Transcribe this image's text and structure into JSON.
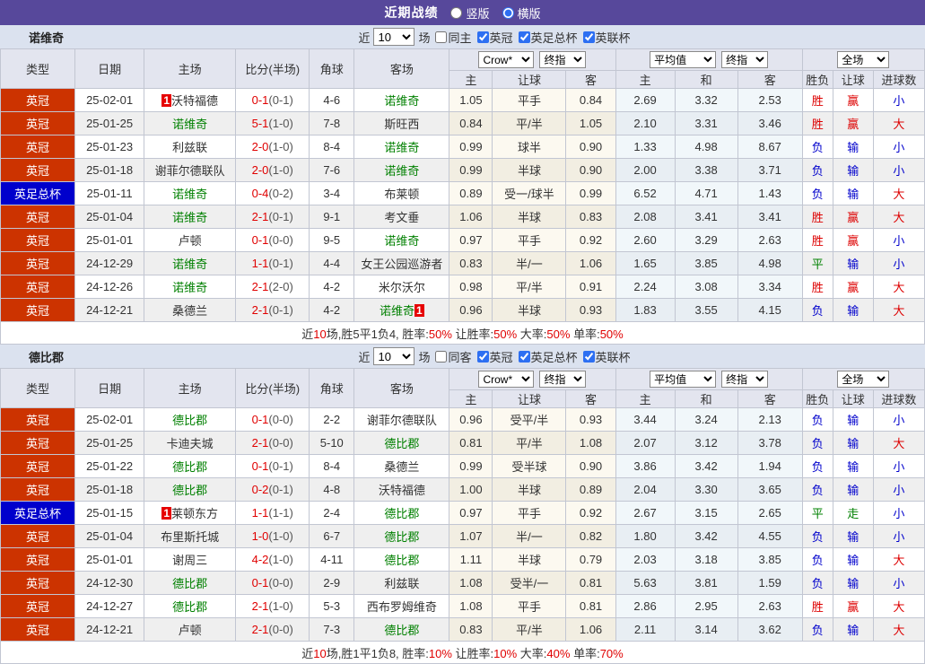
{
  "topbar": {
    "title": "近期战绩",
    "layout_options": [
      {
        "label": "竖版",
        "selected": false
      },
      {
        "label": "横版",
        "selected": true
      }
    ]
  },
  "filter": {
    "near_label": "近",
    "count_value": "10",
    "count_suffix": "场"
  },
  "header": {
    "left_cols": [
      "类型",
      "日期",
      "主场",
      "比分(半场)",
      "角球",
      "客场"
    ],
    "odds_group": {
      "dropdowns": [
        "Crow*",
        "终指"
      ],
      "cols": [
        "主",
        "让球",
        "客"
      ]
    },
    "avg_group": {
      "dropdowns": [
        "平均值",
        "终指"
      ],
      "cols": [
        "主",
        "和",
        "客"
      ]
    },
    "result_group": {
      "dropdowns": [
        "全场"
      ],
      "cols": [
        "胜负",
        "让球",
        "进球数"
      ]
    }
  },
  "colors": {
    "accent_purple": "#57489B",
    "team_highlight": "#008000",
    "type": {
      "英冠": "#CC3300",
      "英足总杯": "#0000CC"
    },
    "outcome": {
      "胜": "#DD0000",
      "赢": "#DD0000",
      "大": "#DD0000",
      "负": "#0000CC",
      "输": "#0000CC",
      "小": "#0000CC",
      "平": "#008000",
      "走": "#008000"
    }
  },
  "sections": [
    {
      "team": "诺维奇",
      "same_filter": {
        "label": "同主",
        "checked": false
      },
      "league_filters": [
        {
          "label": "英冠",
          "checked": true
        },
        {
          "label": "英足总杯",
          "checked": true
        },
        {
          "label": "英联杯",
          "checked": true
        }
      ],
      "rows": [
        {
          "type": "英冠",
          "date": "25-02-01",
          "home": {
            "name": "沃特福德",
            "hl": false,
            "badge": "1",
            "badge_pos": "before"
          },
          "score": "0-1",
          "half": "(0-1)",
          "corners": "4-6",
          "away": {
            "name": "诺维奇",
            "hl": true
          },
          "odds": [
            "1.05",
            "平手",
            "0.84"
          ],
          "avg": [
            "2.69",
            "3.32",
            "2.53"
          ],
          "results": [
            "胜",
            "赢",
            "小"
          ]
        },
        {
          "type": "英冠",
          "date": "25-01-25",
          "home": {
            "name": "诺维奇",
            "hl": true
          },
          "score": "5-1",
          "half": "(1-0)",
          "corners": "7-8",
          "away": {
            "name": "斯旺西",
            "hl": false
          },
          "odds": [
            "0.84",
            "平/半",
            "1.05"
          ],
          "avg": [
            "2.10",
            "3.31",
            "3.46"
          ],
          "results": [
            "胜",
            "赢",
            "大"
          ]
        },
        {
          "type": "英冠",
          "date": "25-01-23",
          "home": {
            "name": "利兹联",
            "hl": false
          },
          "score": "2-0",
          "half": "(1-0)",
          "corners": "8-4",
          "away": {
            "name": "诺维奇",
            "hl": true
          },
          "odds": [
            "0.99",
            "球半",
            "0.90"
          ],
          "avg": [
            "1.33",
            "4.98",
            "8.67"
          ],
          "results": [
            "负",
            "输",
            "小"
          ]
        },
        {
          "type": "英冠",
          "date": "25-01-18",
          "home": {
            "name": "谢菲尔德联队",
            "hl": false
          },
          "score": "2-0",
          "half": "(1-0)",
          "corners": "7-6",
          "away": {
            "name": "诺维奇",
            "hl": true
          },
          "odds": [
            "0.99",
            "半球",
            "0.90"
          ],
          "avg": [
            "2.00",
            "3.38",
            "3.71"
          ],
          "results": [
            "负",
            "输",
            "小"
          ]
        },
        {
          "type": "英足总杯",
          "date": "25-01-11",
          "home": {
            "name": "诺维奇",
            "hl": true
          },
          "score": "0-4",
          "half": "(0-2)",
          "corners": "3-4",
          "away": {
            "name": "布莱顿",
            "hl": false
          },
          "odds": [
            "0.89",
            "受一/球半",
            "0.99"
          ],
          "avg": [
            "6.52",
            "4.71",
            "1.43"
          ],
          "results": [
            "负",
            "输",
            "大"
          ]
        },
        {
          "type": "英冠",
          "date": "25-01-04",
          "home": {
            "name": "诺维奇",
            "hl": true
          },
          "score": "2-1",
          "half": "(0-1)",
          "corners": "9-1",
          "away": {
            "name": "考文垂",
            "hl": false
          },
          "odds": [
            "1.06",
            "半球",
            "0.83"
          ],
          "avg": [
            "2.08",
            "3.41",
            "3.41"
          ],
          "results": [
            "胜",
            "赢",
            "大"
          ]
        },
        {
          "type": "英冠",
          "date": "25-01-01",
          "home": {
            "name": "卢顿",
            "hl": false
          },
          "score": "0-1",
          "half": "(0-0)",
          "corners": "9-5",
          "away": {
            "name": "诺维奇",
            "hl": true
          },
          "odds": [
            "0.97",
            "平手",
            "0.92"
          ],
          "avg": [
            "2.60",
            "3.29",
            "2.63"
          ],
          "results": [
            "胜",
            "赢",
            "小"
          ]
        },
        {
          "type": "英冠",
          "date": "24-12-29",
          "home": {
            "name": "诺维奇",
            "hl": true
          },
          "score": "1-1",
          "half": "(0-1)",
          "corners": "4-4",
          "away": {
            "name": "女王公园巡游者",
            "hl": false
          },
          "odds": [
            "0.83",
            "半/一",
            "1.06"
          ],
          "avg": [
            "1.65",
            "3.85",
            "4.98"
          ],
          "results": [
            "平",
            "输",
            "小"
          ]
        },
        {
          "type": "英冠",
          "date": "24-12-26",
          "home": {
            "name": "诺维奇",
            "hl": true
          },
          "score": "2-1",
          "half": "(2-0)",
          "corners": "4-2",
          "away": {
            "name": "米尔沃尔",
            "hl": false
          },
          "odds": [
            "0.98",
            "平/半",
            "0.91"
          ],
          "avg": [
            "2.24",
            "3.08",
            "3.34"
          ],
          "results": [
            "胜",
            "赢",
            "大"
          ]
        },
        {
          "type": "英冠",
          "date": "24-12-21",
          "home": {
            "name": "桑德兰",
            "hl": false
          },
          "score": "2-1",
          "half": "(0-1)",
          "corners": "4-2",
          "away": {
            "name": "诺维奇",
            "hl": true,
            "badge": "1",
            "badge_pos": "after"
          },
          "odds": [
            "0.96",
            "半球",
            "0.93"
          ],
          "avg": [
            "1.83",
            "3.55",
            "4.15"
          ],
          "results": [
            "负",
            "输",
            "大"
          ]
        }
      ],
      "summary": [
        [
          "近",
          "d"
        ],
        [
          "10",
          "r"
        ],
        [
          "场,胜5平1负4, 胜率:",
          "d"
        ],
        [
          "50%",
          "r"
        ],
        [
          " 让胜率:",
          "d"
        ],
        [
          "50%",
          "r"
        ],
        [
          " 大率:",
          "d"
        ],
        [
          "50%",
          "r"
        ],
        [
          " 单率:",
          "d"
        ],
        [
          "50%",
          "r"
        ]
      ]
    },
    {
      "team": "德比郡",
      "same_filter": {
        "label": "同客",
        "checked": false
      },
      "league_filters": [
        {
          "label": "英冠",
          "checked": true
        },
        {
          "label": "英足总杯",
          "checked": true
        },
        {
          "label": "英联杯",
          "checked": true
        }
      ],
      "rows": [
        {
          "type": "英冠",
          "date": "25-02-01",
          "home": {
            "name": "德比郡",
            "hl": true
          },
          "score": "0-1",
          "half": "(0-0)",
          "corners": "2-2",
          "away": {
            "name": "谢菲尔德联队",
            "hl": false
          },
          "odds": [
            "0.96",
            "受平/半",
            "0.93"
          ],
          "avg": [
            "3.44",
            "3.24",
            "2.13"
          ],
          "results": [
            "负",
            "输",
            "小"
          ]
        },
        {
          "type": "英冠",
          "date": "25-01-25",
          "home": {
            "name": "卡迪夫城",
            "hl": false
          },
          "score": "2-1",
          "half": "(0-0)",
          "corners": "5-10",
          "away": {
            "name": "德比郡",
            "hl": true
          },
          "odds": [
            "0.81",
            "平/半",
            "1.08"
          ],
          "avg": [
            "2.07",
            "3.12",
            "3.78"
          ],
          "results": [
            "负",
            "输",
            "大"
          ]
        },
        {
          "type": "英冠",
          "date": "25-01-22",
          "home": {
            "name": "德比郡",
            "hl": true
          },
          "score": "0-1",
          "half": "(0-1)",
          "corners": "8-4",
          "away": {
            "name": "桑德兰",
            "hl": false
          },
          "odds": [
            "0.99",
            "受半球",
            "0.90"
          ],
          "avg": [
            "3.86",
            "3.42",
            "1.94"
          ],
          "results": [
            "负",
            "输",
            "小"
          ]
        },
        {
          "type": "英冠",
          "date": "25-01-18",
          "home": {
            "name": "德比郡",
            "hl": true
          },
          "score": "0-2",
          "half": "(0-1)",
          "corners": "4-8",
          "away": {
            "name": "沃特福德",
            "hl": false
          },
          "odds": [
            "1.00",
            "半球",
            "0.89"
          ],
          "avg": [
            "2.04",
            "3.30",
            "3.65"
          ],
          "results": [
            "负",
            "输",
            "小"
          ]
        },
        {
          "type": "英足总杯",
          "date": "25-01-15",
          "home": {
            "name": "莱顿东方",
            "hl": false,
            "badge": "1",
            "badge_pos": "before"
          },
          "score": "1-1",
          "half": "(1-1)",
          "corners": "2-4",
          "away": {
            "name": "德比郡",
            "hl": true
          },
          "odds": [
            "0.97",
            "平手",
            "0.92"
          ],
          "avg": [
            "2.67",
            "3.15",
            "2.65"
          ],
          "results": [
            "平",
            "走",
            "小"
          ]
        },
        {
          "type": "英冠",
          "date": "25-01-04",
          "home": {
            "name": "布里斯托城",
            "hl": false
          },
          "score": "1-0",
          "half": "(1-0)",
          "corners": "6-7",
          "away": {
            "name": "德比郡",
            "hl": true
          },
          "odds": [
            "1.07",
            "半/一",
            "0.82"
          ],
          "avg": [
            "1.80",
            "3.42",
            "4.55"
          ],
          "results": [
            "负",
            "输",
            "小"
          ]
        },
        {
          "type": "英冠",
          "date": "25-01-01",
          "home": {
            "name": "谢周三",
            "hl": false
          },
          "score": "4-2",
          "half": "(1-0)",
          "corners": "4-11",
          "away": {
            "name": "德比郡",
            "hl": true
          },
          "odds": [
            "1.11",
            "半球",
            "0.79"
          ],
          "avg": [
            "2.03",
            "3.18",
            "3.85"
          ],
          "results": [
            "负",
            "输",
            "大"
          ]
        },
        {
          "type": "英冠",
          "date": "24-12-30",
          "home": {
            "name": "德比郡",
            "hl": true
          },
          "score": "0-1",
          "half": "(0-0)",
          "corners": "2-9",
          "away": {
            "name": "利兹联",
            "hl": false
          },
          "odds": [
            "1.08",
            "受半/一",
            "0.81"
          ],
          "avg": [
            "5.63",
            "3.81",
            "1.59"
          ],
          "results": [
            "负",
            "输",
            "小"
          ]
        },
        {
          "type": "英冠",
          "date": "24-12-27",
          "home": {
            "name": "德比郡",
            "hl": true
          },
          "score": "2-1",
          "half": "(1-0)",
          "corners": "5-3",
          "away": {
            "name": "西布罗姆维奇",
            "hl": false
          },
          "odds": [
            "1.08",
            "平手",
            "0.81"
          ],
          "avg": [
            "2.86",
            "2.95",
            "2.63"
          ],
          "results": [
            "胜",
            "赢",
            "大"
          ]
        },
        {
          "type": "英冠",
          "date": "24-12-21",
          "home": {
            "name": "卢顿",
            "hl": false
          },
          "score": "2-1",
          "half": "(0-0)",
          "corners": "7-3",
          "away": {
            "name": "德比郡",
            "hl": true
          },
          "odds": [
            "0.83",
            "平/半",
            "1.06"
          ],
          "avg": [
            "2.11",
            "3.14",
            "3.62"
          ],
          "results": [
            "负",
            "输",
            "大"
          ]
        }
      ],
      "summary": [
        [
          "近",
          "d"
        ],
        [
          "10",
          "r"
        ],
        [
          "场,胜1平1负8, 胜率:",
          "d"
        ],
        [
          "10%",
          "r"
        ],
        [
          " 让胜率:",
          "d"
        ],
        [
          "10%",
          "r"
        ],
        [
          " 大率:",
          "d"
        ],
        [
          "40%",
          "r"
        ],
        [
          " 单率:",
          "d"
        ],
        [
          "70%",
          "r"
        ]
      ]
    }
  ]
}
